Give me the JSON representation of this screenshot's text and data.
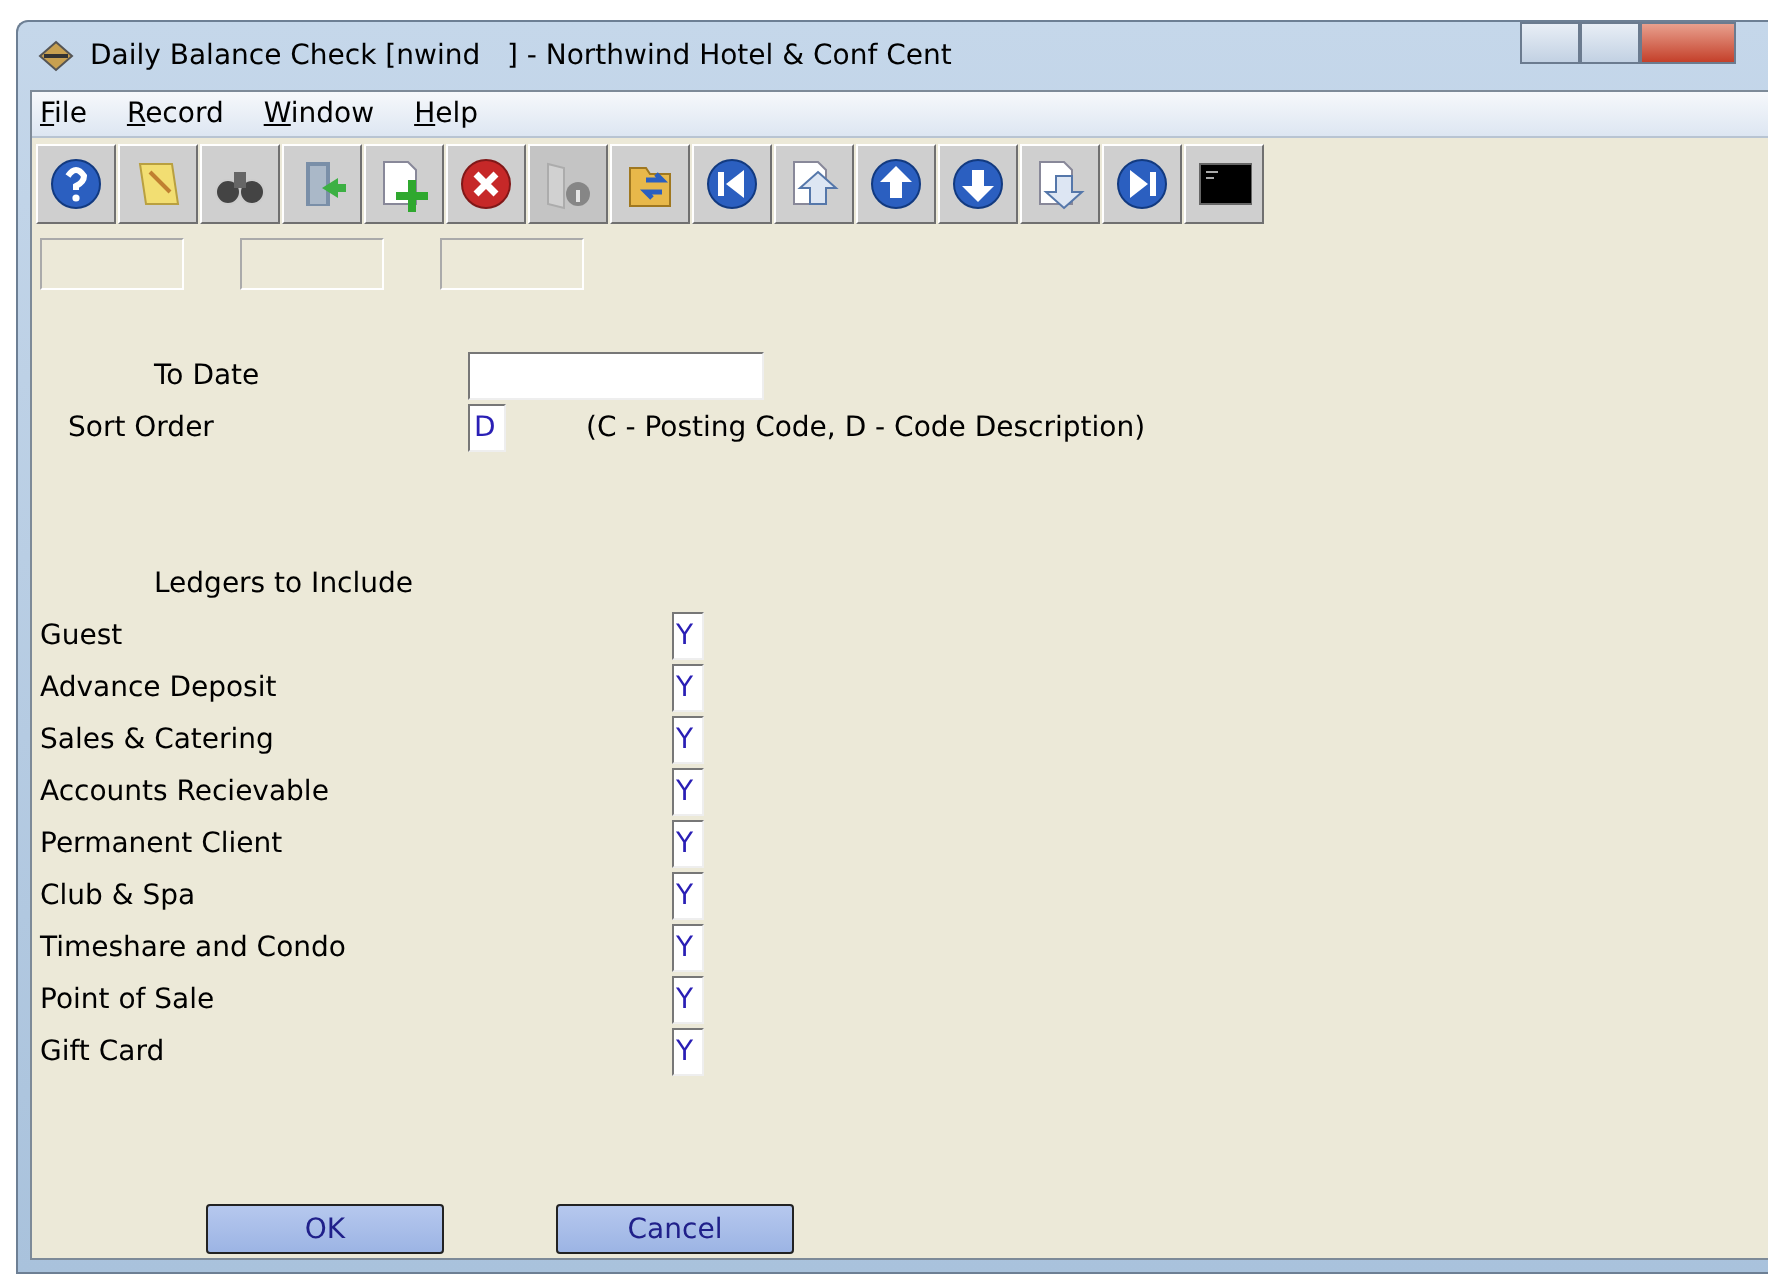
{
  "window": {
    "title": "Daily Balance Check [nwind   ] - Northwind Hotel & Conf Cent"
  },
  "menu": [
    "File",
    "Record",
    "Window",
    "Help"
  ],
  "toolbar": [
    {
      "kind": "help",
      "disabled": false
    },
    {
      "kind": "note",
      "disabled": false
    },
    {
      "kind": "binoculars",
      "disabled": false
    },
    {
      "kind": "door",
      "disabled": false
    },
    {
      "kind": "add",
      "disabled": false
    },
    {
      "kind": "delete",
      "disabled": false
    },
    {
      "kind": "info",
      "disabled": true
    },
    {
      "kind": "folder",
      "disabled": false
    },
    {
      "kind": "first",
      "disabled": false
    },
    {
      "kind": "docup",
      "disabled": false
    },
    {
      "kind": "up",
      "disabled": false
    },
    {
      "kind": "down",
      "disabled": false
    },
    {
      "kind": "docdown",
      "disabled": false
    },
    {
      "kind": "last",
      "disabled": false
    },
    {
      "kind": "terminal",
      "disabled": false
    }
  ],
  "to_date": {
    "label": "To Date"
  },
  "sort_order": {
    "label": "Sort Order",
    "value": "D",
    "hint": "(C - Posting Code, D - Code Description)"
  },
  "ledgers": {
    "heading": "Ledgers to Include",
    "items": [
      {
        "label": "Guest",
        "value": "Y"
      },
      {
        "label": "Advance Deposit",
        "value": "Y"
      },
      {
        "label": "Sales & Catering",
        "value": "Y"
      },
      {
        "label": "Accounts Recievable",
        "value": "Y"
      },
      {
        "label": "Permanent Client",
        "value": "Y"
      },
      {
        "label": "Club & Spa",
        "value": "Y"
      },
      {
        "label": "Timeshare and Condo",
        "value": "Y"
      },
      {
        "label": "Point of Sale",
        "value": "Y"
      },
      {
        "label": "Gift Card",
        "value": "Y"
      }
    ]
  },
  "buttons": [
    "OK",
    "Cancel"
  ]
}
